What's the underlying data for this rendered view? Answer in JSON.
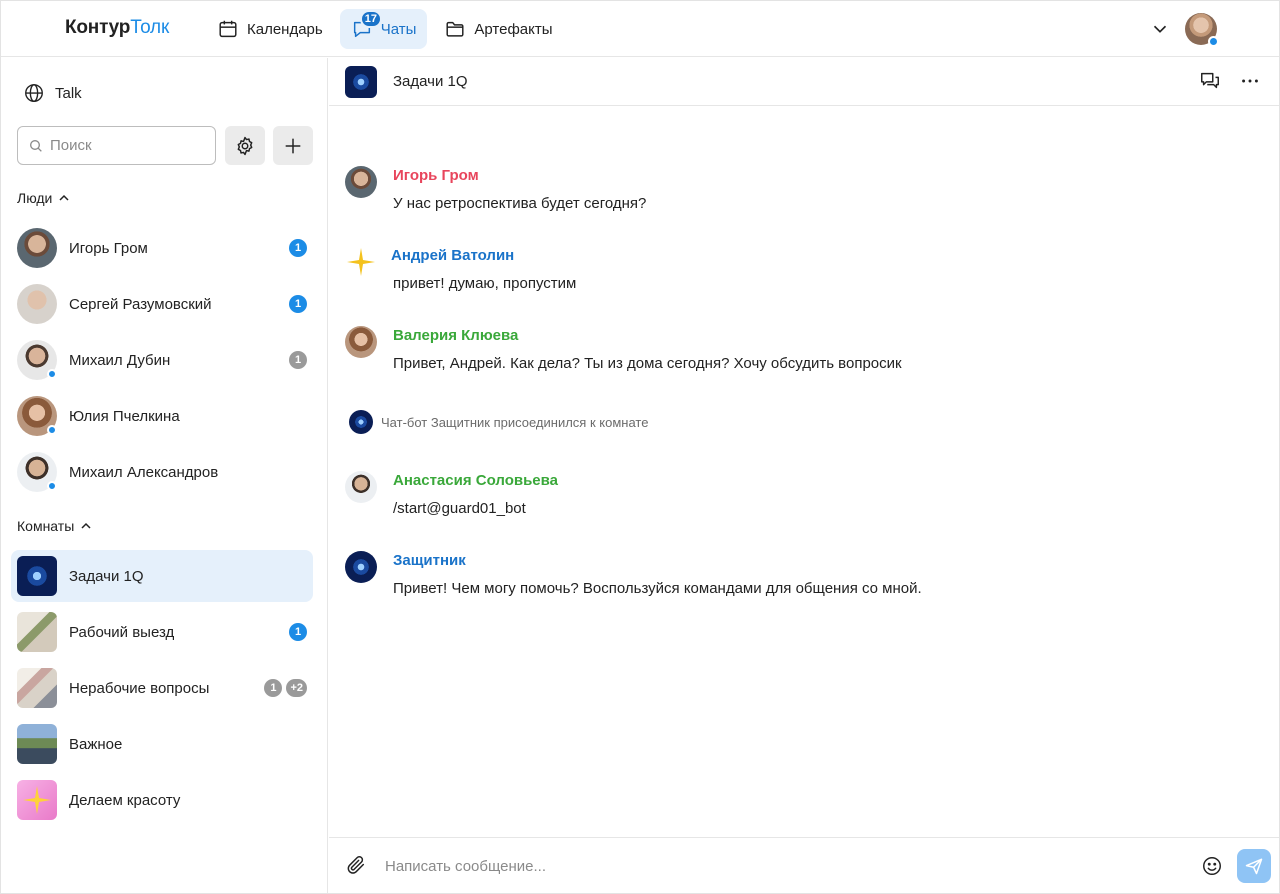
{
  "brand": {
    "part1": "Контур",
    "part2": "Толк",
    "accent_color": "#1c8ce6"
  },
  "nav": [
    {
      "label": "Календарь",
      "icon": "calendar-icon"
    },
    {
      "label": "Чаты",
      "icon": "chat-icon",
      "badge": "17",
      "active": true
    },
    {
      "label": "Артефакты",
      "icon": "folder-icon"
    }
  ],
  "sidebar": {
    "workspace": "Talk",
    "search_placeholder": "Поиск",
    "people_header": "Люди",
    "rooms_header": "Комнаты",
    "people": [
      {
        "name": "Игорь Гром",
        "badges": [
          {
            "text": "1",
            "color": "blue"
          }
        ],
        "online": false
      },
      {
        "name": "Сергей Разумовский",
        "badges": [
          {
            "text": "1",
            "color": "blue"
          }
        ],
        "online": false
      },
      {
        "name": "Михаил Дубин",
        "badges": [
          {
            "text": "1",
            "color": "gray"
          }
        ],
        "online": true
      },
      {
        "name": "Юлия Пчелкина",
        "badges": [],
        "online": true
      },
      {
        "name": "Михаил Александров",
        "badges": [],
        "online": true
      }
    ],
    "rooms": [
      {
        "name": "Задачи 1Q",
        "badges": [],
        "active": true
      },
      {
        "name": "Рабочий выезд",
        "badges": [
          {
            "text": "1",
            "color": "blue"
          }
        ]
      },
      {
        "name": "Нерабочие вопросы",
        "badges": [
          {
            "text": "1",
            "color": "gray"
          },
          {
            "text": "+2",
            "color": "gray"
          }
        ]
      },
      {
        "name": "Важное",
        "badges": []
      },
      {
        "name": "Делаем красоту",
        "badges": []
      }
    ]
  },
  "chat": {
    "title": "Задачи 1Q",
    "messages": [
      {
        "author": "Игорь Гром",
        "color": "#e8455c",
        "text": "У нас ретроспектива будет сегодня?"
      },
      {
        "author": "Андрей Ватолин",
        "color": "#1a73c9",
        "text": "привет! думаю, пропустим"
      },
      {
        "author": "Валерия Клюева",
        "color": "#3aa83a",
        "text": "Привет, Андрей. Как дела? Ты из дома сегодня? Хочу обсудить вопросик"
      },
      {
        "author": "Анастасия Соловьева",
        "color": "#3aa83a",
        "text": "/start@guard01_bot"
      },
      {
        "author": "Защитник",
        "color": "#1a73c9",
        "text": "Привет! Чем могу помочь? Воспользуйся командами для общения со мной."
      }
    ],
    "system_message": "Чат-бот Защитник присоединился к комнате",
    "composer_placeholder": "Написать сообщение..."
  }
}
